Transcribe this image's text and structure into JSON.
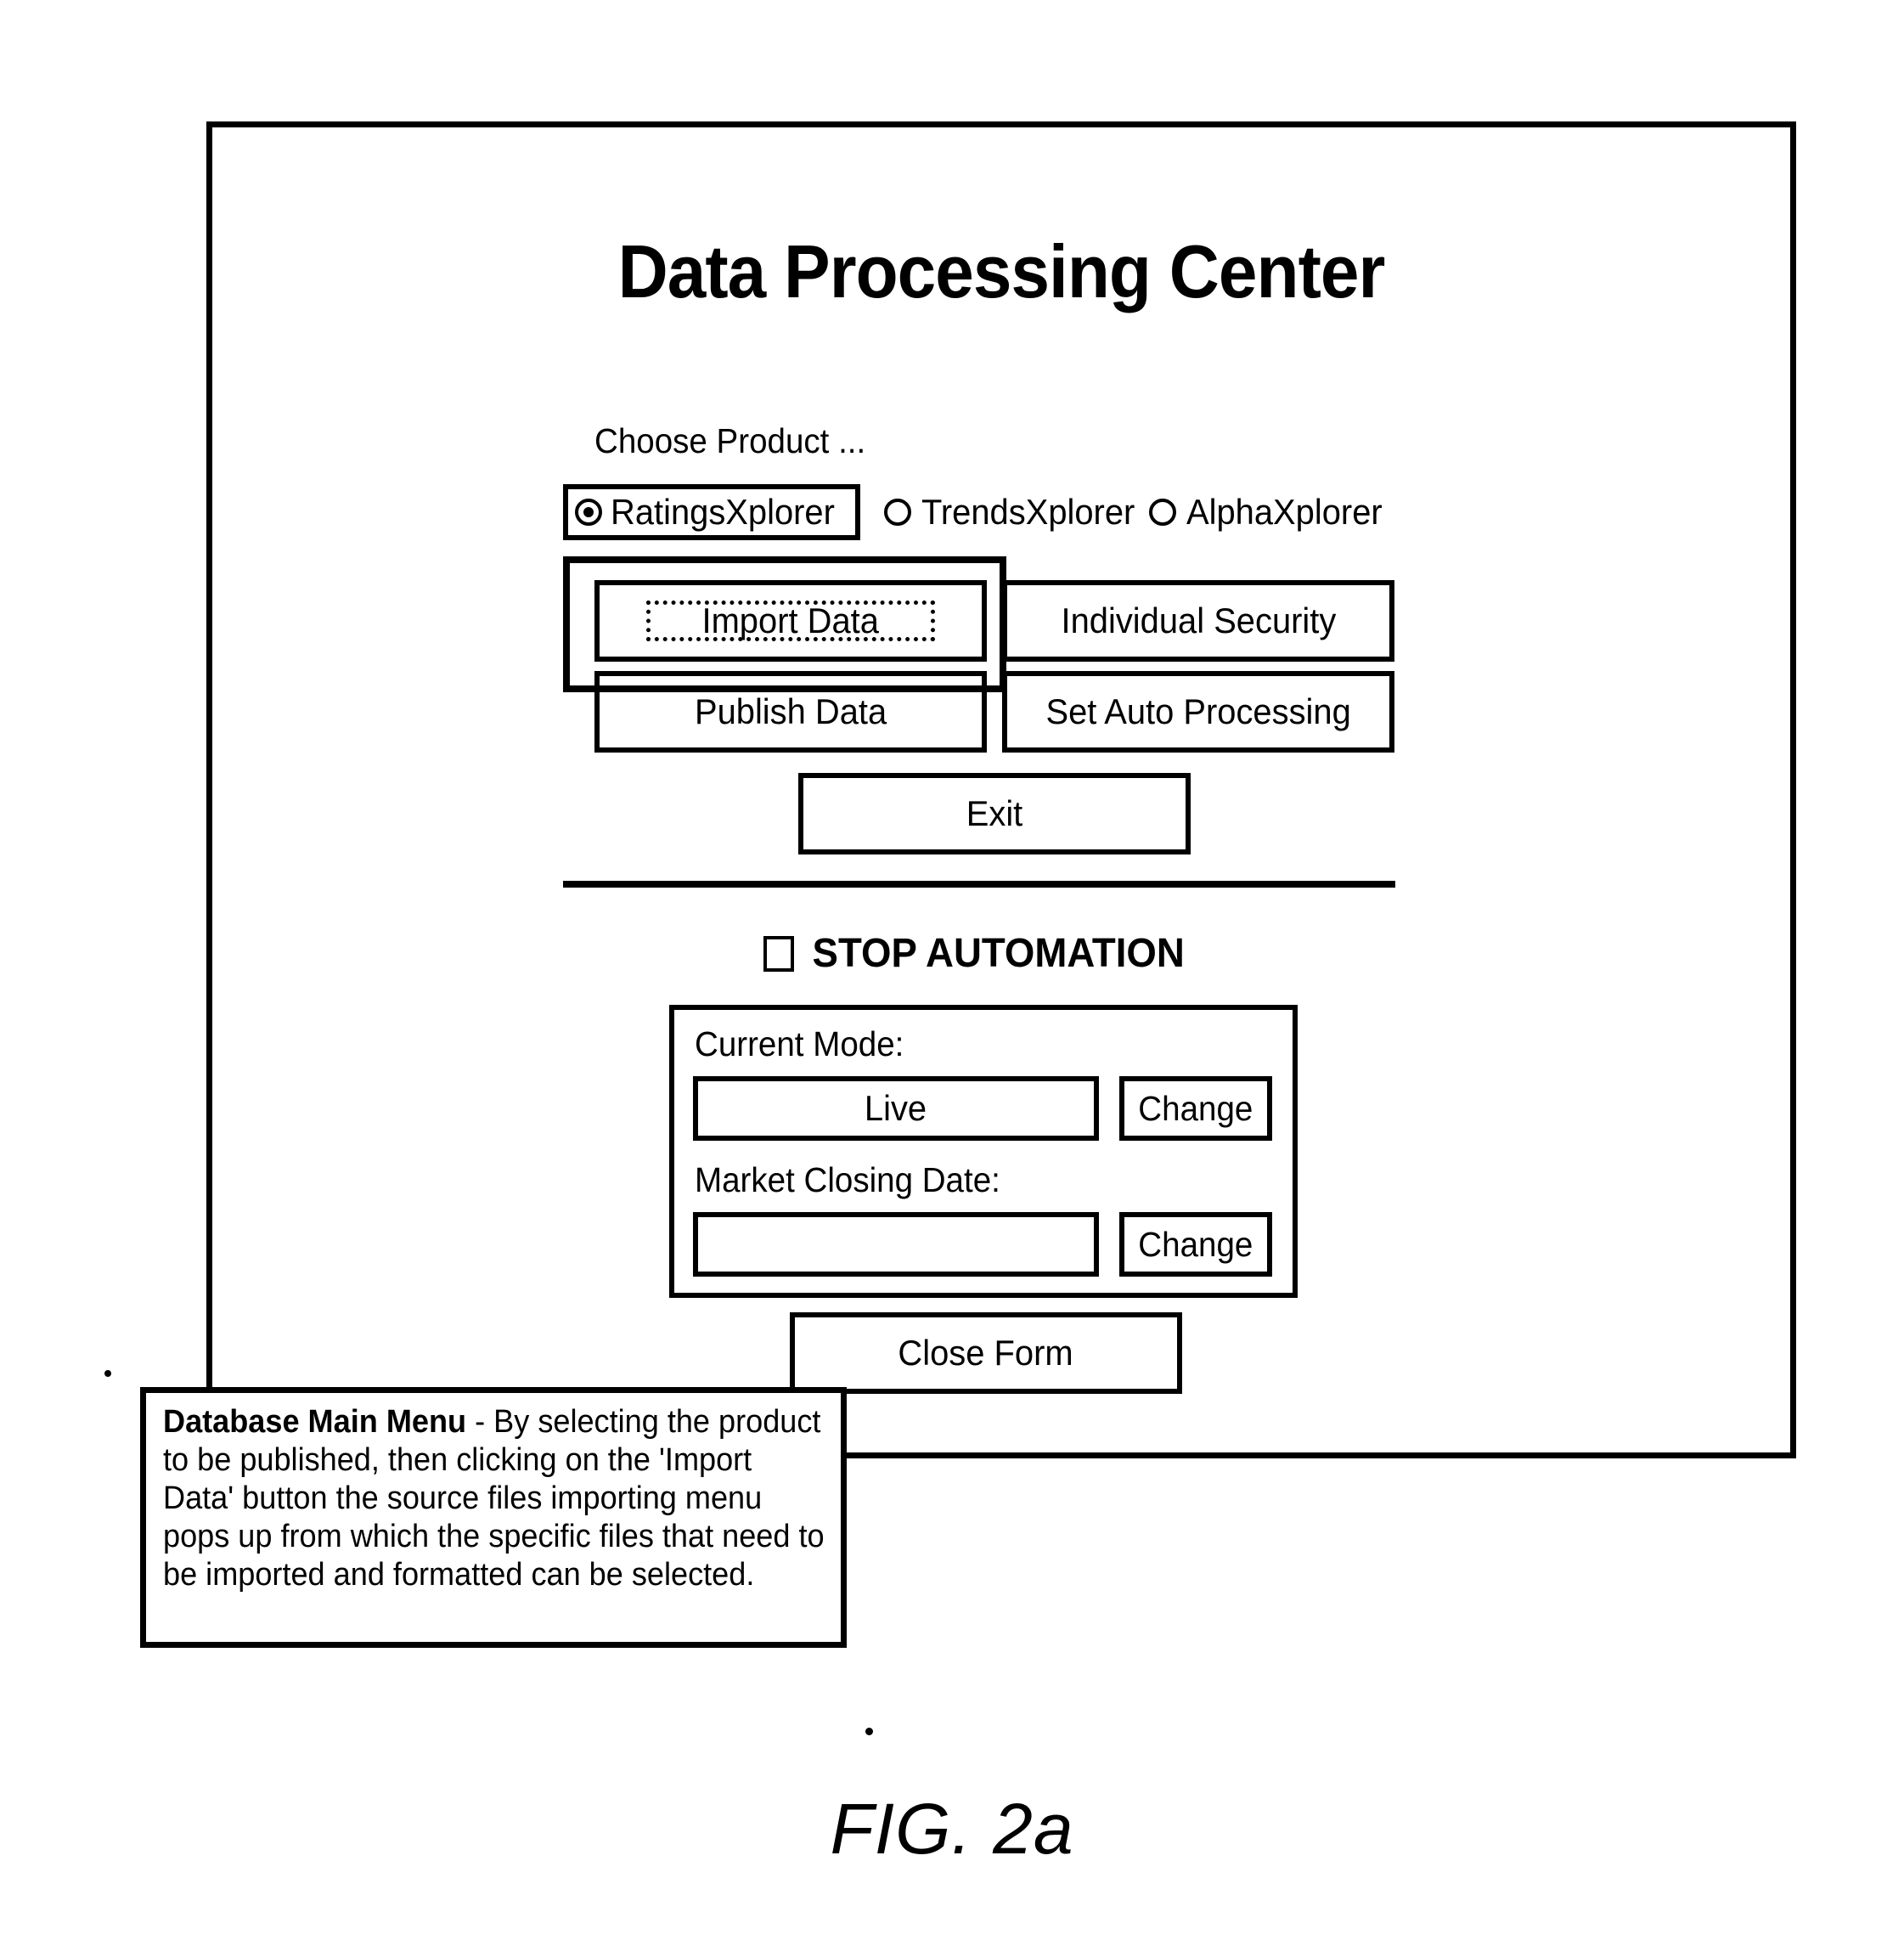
{
  "figure": {
    "label": "FIG. 2a"
  },
  "window": {
    "title": "Data Processing Center"
  },
  "product_chooser": {
    "label": "Choose Product ...",
    "options": [
      {
        "label": "RatingsXplorer",
        "selected": true,
        "focused": true
      },
      {
        "label": "TrendsXplorer",
        "selected": false,
        "focused": false
      },
      {
        "label": "AlphaXplorer",
        "selected": false,
        "focused": false
      }
    ]
  },
  "commands": {
    "import_data": "Import Data",
    "publish_data": "Publish Data",
    "individual_security": "Individual Security",
    "set_auto_processing": "Set Auto Processing",
    "exit": "Exit",
    "close_form": "Close Form"
  },
  "automation": {
    "stop_label": "STOP AUTOMATION",
    "stop_checked": false
  },
  "settings": {
    "current_mode_label": "Current Mode:",
    "current_mode_value": "Live",
    "current_mode_change": "Change",
    "market_closing_date_label": "Market Closing Date:",
    "market_closing_date_value": "",
    "market_closing_date_change": "Change"
  },
  "caption": {
    "title": "Database Main Menu",
    "body": " - By selecting the product to be published, then clicking on the 'Import Data' button the source files importing menu pops up from which the specific files that need to be imported and formatted can be selected."
  },
  "colors": {
    "ink": "#000000",
    "paper": "#ffffff"
  }
}
